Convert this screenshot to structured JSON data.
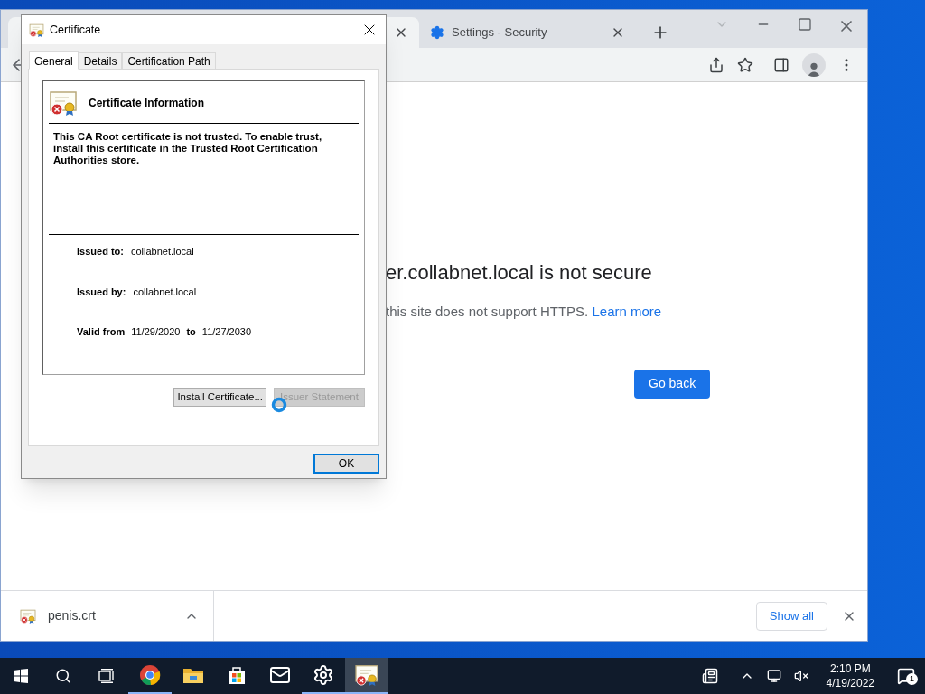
{
  "browser": {
    "tabs": [
      {
        "selected": true
      },
      {
        "title": "Settings - Security",
        "selected": false
      }
    ],
    "page": {
      "heading": "er.collabnet.local is not secure",
      "message": "this site does not support HTTPS.",
      "link": "Learn more",
      "button": "Go back"
    },
    "downloads": {
      "file": "penis.crt",
      "show_all": "Show all"
    }
  },
  "dialog": {
    "title": "Certificate",
    "tabs": [
      {
        "label": "General",
        "selected": true
      },
      {
        "label": "Details",
        "selected": false
      },
      {
        "label": "Certification Path",
        "selected": false
      }
    ],
    "info_title": "Certificate Information",
    "message": "This CA Root certificate is not trusted. To enable trust, install this certificate in the Trusted Root Certification Authorities store.",
    "fields": [
      {
        "label": "Issued to:",
        "value": "collabnet.local"
      },
      {
        "label": "Issued by:",
        "value": "collabnet.local"
      }
    ],
    "valid": {
      "label": "Valid from",
      "from": "11/29/2020",
      "to_label": "to",
      "to": "11/27/2030"
    },
    "buttons": [
      {
        "label": "Install Certificate...",
        "disabled": false
      },
      {
        "label": "Issuer Statement",
        "disabled": true
      }
    ],
    "ok": "OK"
  },
  "taskbar": {
    "apps": [
      {
        "kind": "chrome",
        "running": true,
        "selected": false
      },
      {
        "kind": "folder",
        "running": false,
        "selected": false
      },
      {
        "kind": "store",
        "running": false,
        "selected": false
      },
      {
        "kind": "mail",
        "running": false,
        "selected": false
      },
      {
        "kind": "settings",
        "running": true,
        "selected": false
      },
      {
        "kind": "certificate",
        "running": true,
        "selected": true
      }
    ],
    "time": "2:10 PM",
    "date": "4/19/2022",
    "notifications": "1"
  }
}
